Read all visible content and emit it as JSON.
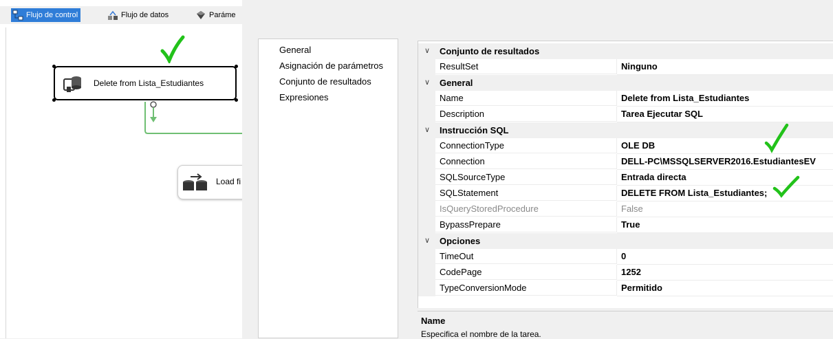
{
  "designer": {
    "tabs": [
      {
        "label": "Flujo de control"
      },
      {
        "label": "Flujo de datos"
      },
      {
        "label": "Paráme"
      }
    ],
    "tasks": {
      "delete": "Delete from Lista_Estudiantes",
      "load": "Load fi"
    }
  },
  "editor": {
    "nav": [
      "General",
      "Asignación de parámetros",
      "Conjunto de resultados",
      "Expresiones"
    ],
    "categories": {
      "resultset": "Conjunto de resultados",
      "general": "General",
      "sql": "Instrucción SQL",
      "options": "Opciones"
    },
    "properties": {
      "resultset": {
        "name": "ResultSet",
        "value": "Ninguno"
      },
      "name": {
        "name": "Name",
        "value": "Delete from Lista_Estudiantes"
      },
      "description": {
        "name": "Description",
        "value": "Tarea Ejecutar SQL"
      },
      "connection_type": {
        "name": "ConnectionType",
        "value": "OLE DB"
      },
      "connection": {
        "name": "Connection",
        "value": "DELL-PC\\MSSQLSERVER2016.EstudiantesEV"
      },
      "sql_source_type": {
        "name": "SQLSourceType",
        "value": "Entrada directa"
      },
      "sql_statement": {
        "name": "SQLStatement",
        "value": "DELETE  FROM Lista_Estudiantes;"
      },
      "is_query_stored_procedure": {
        "name": "IsQueryStoredProcedure",
        "value": "False"
      },
      "bypass_prepare": {
        "name": "BypassPrepare",
        "value": "True"
      },
      "timeout": {
        "name": "TimeOut",
        "value": "0"
      },
      "code_page": {
        "name": "CodePage",
        "value": "1252"
      },
      "type_conversion_mode": {
        "name": "TypeConversionMode",
        "value": "Permitido"
      }
    },
    "description_pane": {
      "title": "Name",
      "text": "Especifica el nombre de la tarea."
    }
  },
  "colors": {
    "accent_tab": "#2f7dd8",
    "check_mark": "#22c21a",
    "connector": "#6fbf73"
  },
  "icons": [
    "control-flow-icon",
    "data-flow-icon",
    "parameters-icon",
    "execute-sql-task-icon",
    "data-flow-task-icon",
    "chevron-down-icon",
    "check-mark-icon"
  ]
}
